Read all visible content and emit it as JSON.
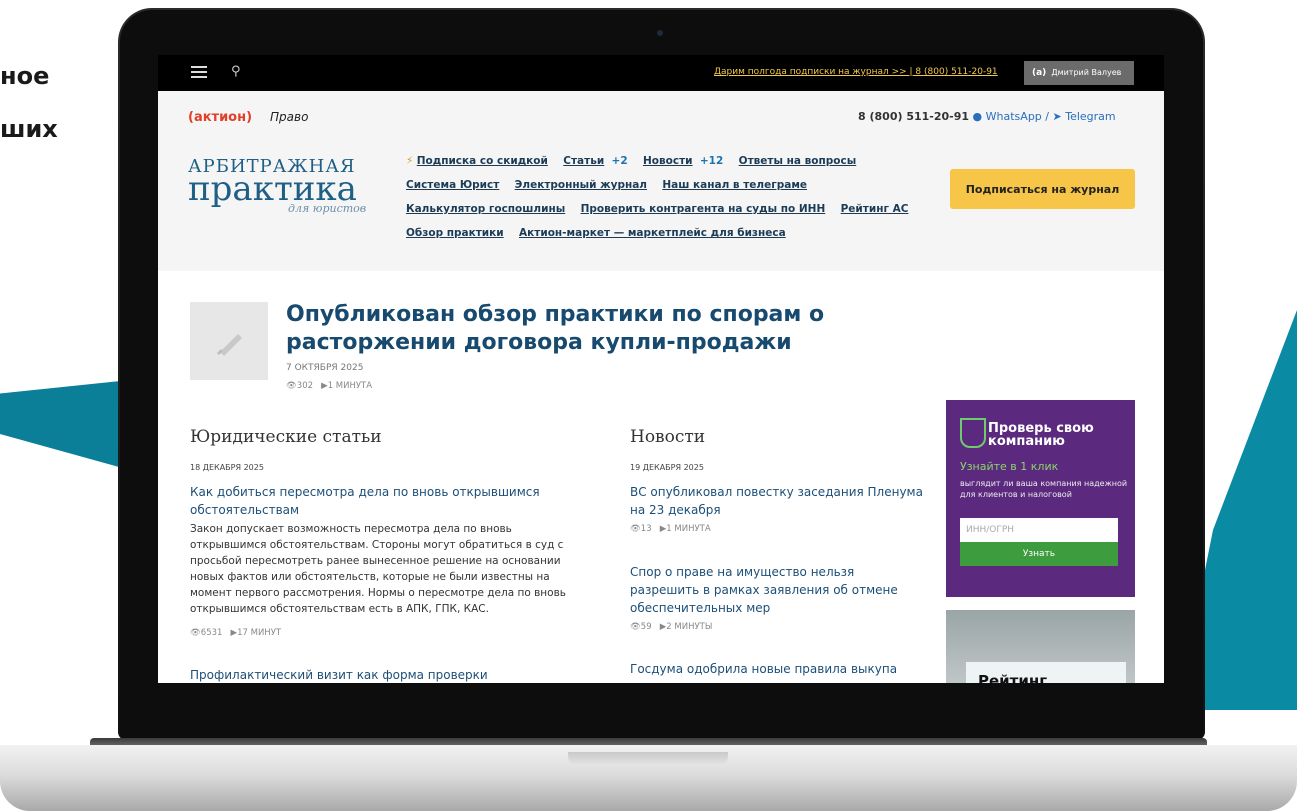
{
  "background": {
    "text_line1": "ное",
    "text_line2": "ших"
  },
  "topbar": {
    "menu_icon": "hamburger-menu-icon",
    "search_icon": "search-icon",
    "promo": "Дарим полгода подписки на журнал >> | 8 (800) 511-20-91",
    "user_badge": "(а)",
    "user_name": "Дмитрий Валуев"
  },
  "header": {
    "brand_aktion": "(актион)",
    "brand_pravo": "Право",
    "phone": "8 (800) 511-20-91",
    "whatsapp": "WhatsApp",
    "separator": "/",
    "telegram": "Telegram",
    "logo_line1": "АРБИТРАЖНАЯ",
    "logo_line2": "практика",
    "logo_line3": "для юристов",
    "nav": {
      "subscription": "Подписка со скидкой",
      "articles": "Статьи",
      "articles_count": "+2",
      "news": "Новости",
      "news_count": "+12",
      "answers": "Ответы на вопросы",
      "system": "Система Юрист",
      "ejournal": "Электронный журнал",
      "telegram_channel": "Наш канал в телеграме",
      "calculator": "Калькулятор госпошлины",
      "check_contractor": "Проверить контрагента на суды по ИНН",
      "rating": "Рейтинг АС",
      "review": "Обзор практики",
      "market": "Актион-маркет — маркетплейс для бизнеса"
    },
    "subscribe_button": "Подписаться на журнал"
  },
  "main_article": {
    "title": "Опубликован обзор практики по спорам о расторжении договора купли-продажи",
    "date": "7 ОКТЯБРЯ 2025",
    "views": "302",
    "read_time": "1 МИНУТА"
  },
  "legal_articles": {
    "section_title": "Юридические статьи",
    "items": [
      {
        "date": "18 ДЕКАБРЯ 2025",
        "title": "Как добиться пересмотра дела по вновь открывшимся обстоятельствам",
        "excerpt": "Закон допускает возможность пересмотра дела по вновь открывшимся обстоятельствам. Стороны могут обратиться в суд с просьбой пересмотреть ранее вынесенное решение на основании новых фактов или обстоятельств, которые не были известны на момент первого рассмотрения. Нормы о пересмотре дела по вновь открывшимся обстоятельствам есть в АПК, ГПК, КАС.",
        "views": "6531",
        "read_time": "17 МИНУТ"
      },
      {
        "title": "Профилактический визит как форма проверки"
      }
    ]
  },
  "news": {
    "section_title": "Новости",
    "items": [
      {
        "date": "19 ДЕКАБРЯ 2025",
        "title": "ВС опубликовал повестку заседания Пленума на 23 декабря",
        "views": "13",
        "read_time": "1 МИНУТА"
      },
      {
        "title": "Спор о праве на имущество нельзя разрешить в рамках заявления об отмене обеспечительных мер",
        "views": "59",
        "read_time": "2 МИНУТЫ"
      },
      {
        "title": "Госдума одобрила новые правила выкупа"
      }
    ]
  },
  "widget": {
    "title": "Проверь свою компанию",
    "subtitle": "Узнайте в 1 клик",
    "description": "выглядит ли ваша компания на­дежной для клиентов и налоговой",
    "input_placeholder": "ИНН/ОГРН",
    "button": "Узнать"
  },
  "banner": {
    "text": "Рейтинг"
  },
  "colors": {
    "accent_red": "#e03f2a",
    "link_blue": "#1c4f78",
    "subscribe_yellow": "#f7c648",
    "widget_purple": "#5b2a7e",
    "widget_green": "#3d9c3d",
    "bg_teal": "#0a8aa3"
  }
}
